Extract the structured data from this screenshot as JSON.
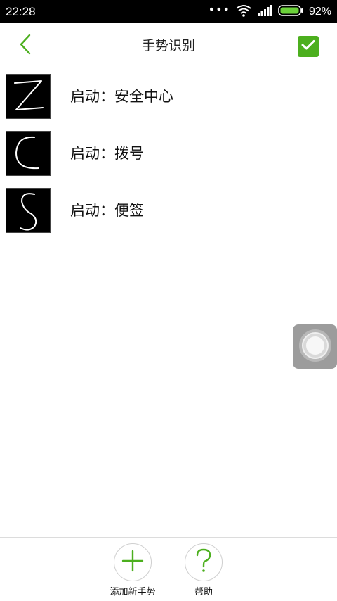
{
  "status_bar": {
    "time": "22:28",
    "battery_percent": "92%",
    "icons": [
      "more-dots-icon",
      "wifi-icon",
      "signal-icon",
      "battery-icon"
    ]
  },
  "header": {
    "title": "手势识别",
    "back_icon": "chevron-left-icon",
    "confirm_icon": "checkbox-checked-icon"
  },
  "gestures": [
    {
      "glyph": "Z",
      "label": "启动：安全中心"
    },
    {
      "glyph": "C",
      "label": "启动：拨号"
    },
    {
      "glyph": "S",
      "label": "启动：便签"
    }
  ],
  "bottom_bar": {
    "add_label": "添加新手势",
    "help_label": "帮助"
  },
  "colors": {
    "accent": "#4caf1e",
    "status_bar": "#000000",
    "float_button": "#9c9c9c"
  }
}
